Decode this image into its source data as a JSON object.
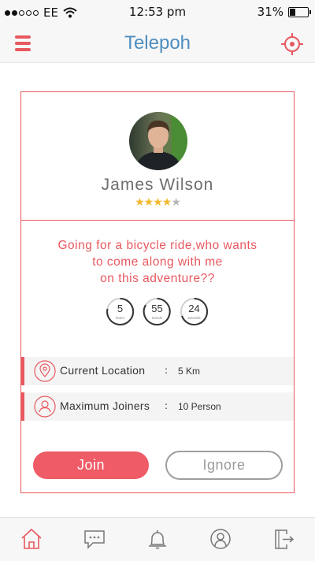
{
  "status_bar": {
    "carrier": "EE",
    "time": "12:53 pm",
    "battery": "31%",
    "battery_level": 0.31
  },
  "nav": {
    "title": "Telepoh",
    "menu_icon": "hamburger-menu-icon",
    "target_icon": "location-target-icon"
  },
  "colors": {
    "accent": "#e8585f",
    "title_blue": "#4d8dbf",
    "star_gold": "#f2b92b"
  },
  "post": {
    "user_name": "James Wilson",
    "rating": 4,
    "rating_max": 5,
    "stars": [
      "★",
      "★",
      "★",
      "★",
      "★"
    ],
    "message_lines": [
      "Going for a bicycle ride,who wants",
      "to come along with me",
      "on this adventure??"
    ],
    "countdown": [
      {
        "value": "5",
        "unit": "hours"
      },
      {
        "value": "55",
        "unit": "minuts"
      },
      {
        "value": "24",
        "unit": "seconds"
      }
    ],
    "details": {
      "location": {
        "label": "Current Location",
        "colon": ":",
        "value": "5 Km",
        "icon": "map-pin-icon"
      },
      "joiners": {
        "label": "Maximum Joiners",
        "colon": ":",
        "value": "10 Person",
        "icon": "user-icon"
      }
    },
    "join_label": "Join",
    "ignore_label": "Ignore"
  },
  "tab_bar": {
    "items": [
      {
        "name": "home",
        "icon": "home-icon",
        "active": true
      },
      {
        "name": "messages",
        "icon": "chat-bubble-icon",
        "active": false
      },
      {
        "name": "notifications",
        "icon": "bell-icon",
        "active": false
      },
      {
        "name": "profile",
        "icon": "profile-icon",
        "active": false
      },
      {
        "name": "logout",
        "icon": "logout-icon",
        "active": false
      }
    ]
  }
}
